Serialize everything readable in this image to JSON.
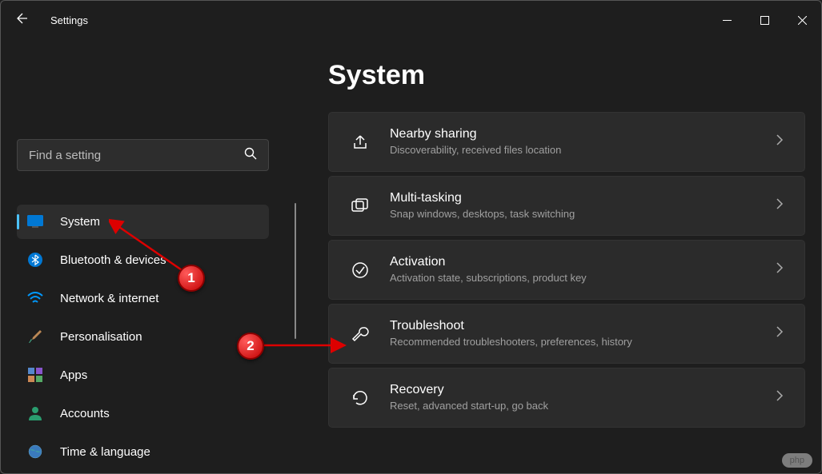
{
  "window": {
    "title": "Settings",
    "controls": {
      "minimize": "—",
      "maximize": "▢",
      "close": "✕"
    }
  },
  "search": {
    "placeholder": "Find a setting"
  },
  "sidebar": {
    "items": [
      {
        "icon": "display",
        "label": "System",
        "active": true
      },
      {
        "icon": "bluetooth",
        "label": "Bluetooth & devices",
        "active": false
      },
      {
        "icon": "wifi",
        "label": "Network & internet",
        "active": false
      },
      {
        "icon": "brush",
        "label": "Personalisation",
        "active": false
      },
      {
        "icon": "apps",
        "label": "Apps",
        "active": false
      },
      {
        "icon": "person",
        "label": "Accounts",
        "active": false
      },
      {
        "icon": "globe",
        "label": "Time & language",
        "active": false
      }
    ]
  },
  "page": {
    "title": "System"
  },
  "settings": {
    "items": [
      {
        "icon": "share",
        "title": "Nearby sharing",
        "desc": "Discoverability, received files location"
      },
      {
        "icon": "multitask",
        "title": "Multi-tasking",
        "desc": "Snap windows, desktops, task switching"
      },
      {
        "icon": "check",
        "title": "Activation",
        "desc": "Activation state, subscriptions, product key"
      },
      {
        "icon": "wrench",
        "title": "Troubleshoot",
        "desc": "Recommended troubleshooters, preferences, history"
      },
      {
        "icon": "recover",
        "title": "Recovery",
        "desc": "Reset, advanced start-up, go back"
      }
    ]
  },
  "annotations": {
    "badge1": "1",
    "badge2": "2"
  },
  "watermark": "php"
}
